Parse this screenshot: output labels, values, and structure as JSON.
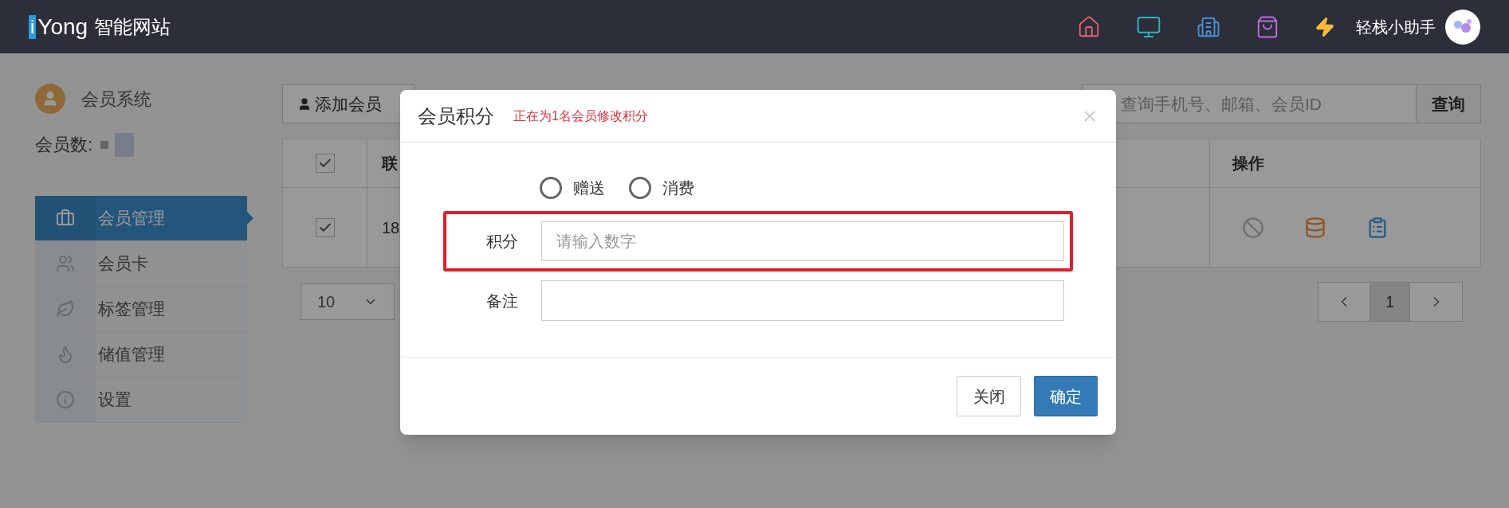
{
  "header": {
    "logo_mark": "i",
    "logo_text": "Yong",
    "site_name": "智能网站",
    "user_name": "轻栈小助手"
  },
  "sidebar": {
    "title": "会员系统",
    "member_count_label": "会员数:",
    "items": [
      {
        "label": "会员管理",
        "selected": true
      },
      {
        "label": "会员卡",
        "selected": false
      },
      {
        "label": "标签管理",
        "selected": false
      },
      {
        "label": "储值管理",
        "selected": false
      },
      {
        "label": "设置",
        "selected": false
      }
    ]
  },
  "toolbar": {
    "add_button": "添加会员",
    "search_placeholder": "查询手机号、邮箱、会员ID",
    "search_button": "查询"
  },
  "table": {
    "header_checked": true,
    "column_2": "联",
    "column_ops": "操作",
    "rows": [
      {
        "checked": true,
        "column_2": "18"
      }
    ]
  },
  "page_size": "10",
  "pagination": {
    "pages": [
      {
        "label": "1",
        "selected": true
      }
    ]
  },
  "dialog": {
    "title": "会员积分",
    "subtitle": "正在为1名会员修改积分",
    "options": [
      {
        "label": "赠送",
        "selected": false
      },
      {
        "label": "消费",
        "selected": false
      }
    ],
    "points_label": "积分",
    "points_placeholder": "请输入数字",
    "note_label": "备注",
    "close_button": "关闭",
    "confirm_button": "确定"
  }
}
